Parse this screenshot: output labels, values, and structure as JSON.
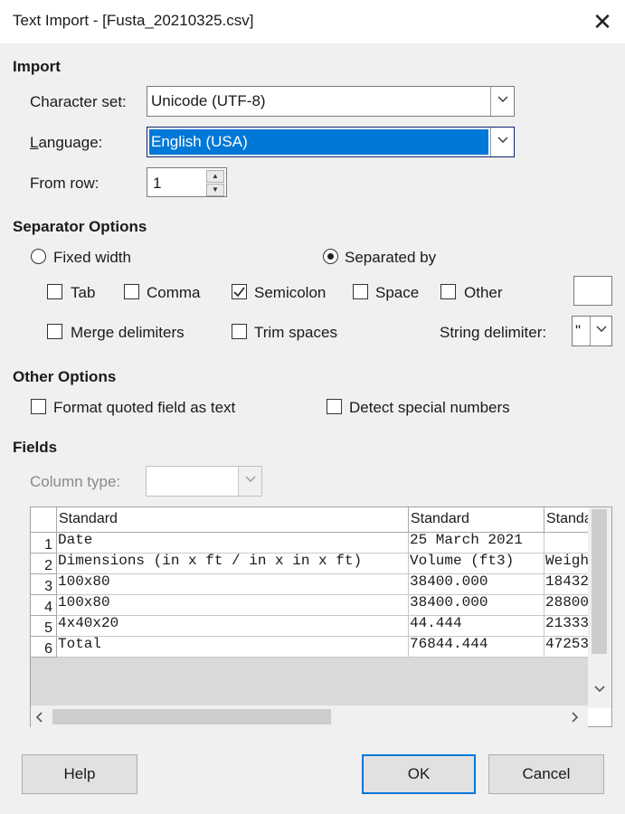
{
  "window": {
    "title": "Text Import - [Fusta_20210325.csv]",
    "close_symbol": "✕"
  },
  "import": {
    "section_label": "Import",
    "charset_label": "Character set:",
    "charset_value": "Unicode (UTF-8)",
    "language_label": "Language:",
    "language_value": "English (USA)",
    "fromrow_label": "From row:",
    "fromrow_value": "1"
  },
  "separator": {
    "section_label": "Separator Options",
    "fixed_width_label": "Fixed width",
    "fixed_width_selected": false,
    "separated_by_label": "Separated by",
    "separated_by_selected": true,
    "tab_label": "Tab",
    "tab_checked": false,
    "comma_label": "Comma",
    "comma_checked": false,
    "semicolon_label": "Semicolon",
    "semicolon_checked": true,
    "space_label": "Space",
    "space_checked": false,
    "other_label": "Other",
    "other_checked": false,
    "other_value": "",
    "merge_label": "Merge delimiters",
    "merge_checked": false,
    "trim_label": "Trim spaces",
    "trim_checked": false,
    "string_delimiter_label": "String delimiter:",
    "string_delimiter_value": "\""
  },
  "other_options": {
    "section_label": "Other Options",
    "format_quoted_label": "Format quoted field as text",
    "format_quoted_checked": false,
    "detect_special_label": "Detect special numbers",
    "detect_special_checked": false
  },
  "fields": {
    "section_label": "Fields",
    "column_type_label": "Column type:",
    "column_type_value": "",
    "headers": [
      "Standard",
      "Standard",
      "Standard"
    ],
    "rows": [
      {
        "num": "1",
        "cells": [
          "Date",
          "25 March 2021",
          ""
        ]
      },
      {
        "num": "2",
        "cells": [
          "Dimensions (in x ft / in x in x ft)",
          "Volume (ft3)",
          "Weight"
        ]
      },
      {
        "num": "3",
        "cells": [
          "100x80",
          "38400.000",
          "18432"
        ]
      },
      {
        "num": "4",
        "cells": [
          "100x80",
          "38400.000",
          "28800"
        ]
      },
      {
        "num": "5",
        "cells": [
          "4x40x20",
          "44.444",
          "21333"
        ]
      },
      {
        "num": "6",
        "cells": [
          "Total",
          "76844.444",
          "47253"
        ]
      }
    ]
  },
  "buttons": {
    "help": "Help",
    "ok": "OK",
    "cancel": "Cancel"
  },
  "colors": {
    "accent": "#0078d7",
    "background": "#f0f0f0"
  }
}
